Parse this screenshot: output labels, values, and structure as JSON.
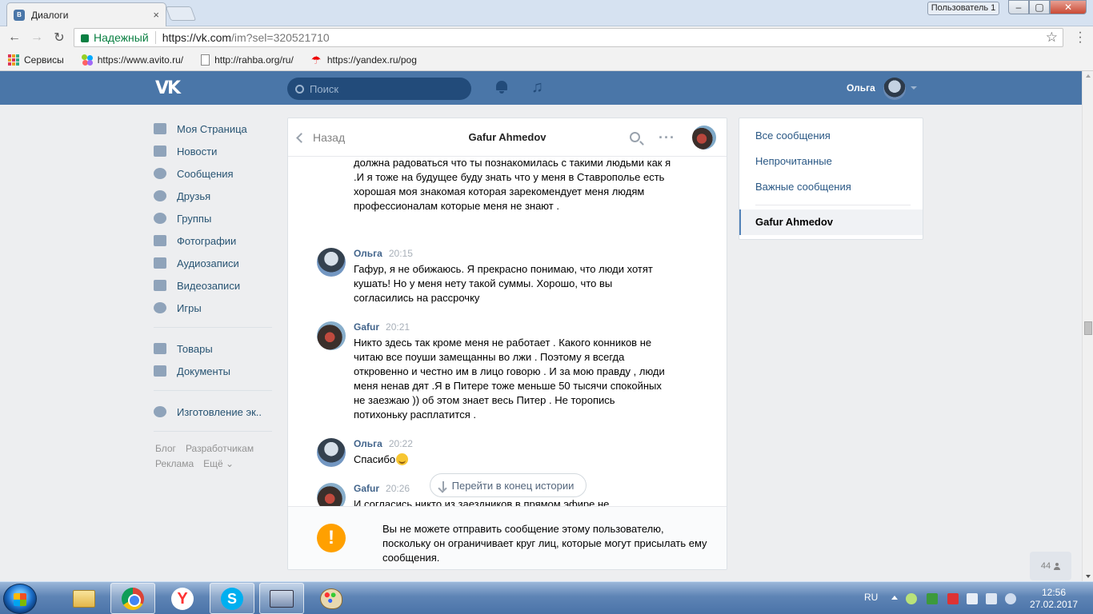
{
  "browser": {
    "tab_title": "Диалоги",
    "tab_close": "×",
    "profile_label": "Пользователь 1",
    "window_buttons": {
      "minimize": "‒",
      "maximize": "▢",
      "close": "✕"
    },
    "secure_label": "Надежный",
    "url_host": "https://vk.com",
    "url_path": "/im?sel=320521710",
    "bookmarks": [
      {
        "label": "Сервисы",
        "icon": "apps-icon"
      },
      {
        "label": "https://www.avito.ru/",
        "icon": "avito-icon"
      },
      {
        "label": "http://rahba.org/ru/",
        "icon": "page-icon"
      },
      {
        "label": "https://yandex.ru/pog",
        "icon": "umbrella-icon"
      }
    ]
  },
  "vk_header": {
    "logo": "VK",
    "search_placeholder": "Поиск",
    "user_name": "Ольга"
  },
  "left_menu": {
    "items": [
      {
        "label": "Моя Страница",
        "icon": "home-icon"
      },
      {
        "label": "Новости",
        "icon": "news-icon"
      },
      {
        "label": "Сообщения",
        "icon": "messages-icon"
      },
      {
        "label": "Друзья",
        "icon": "friends-icon"
      },
      {
        "label": "Группы",
        "icon": "groups-icon"
      },
      {
        "label": "Фотографии",
        "icon": "camera-icon"
      },
      {
        "label": "Аудиозаписи",
        "icon": "music-icon"
      },
      {
        "label": "Видеозаписи",
        "icon": "video-icon"
      },
      {
        "label": "Игры",
        "icon": "gamepad-icon"
      }
    ],
    "items2": [
      {
        "label": "Товары",
        "icon": "bag-icon"
      },
      {
        "label": "Документы",
        "icon": "document-icon"
      }
    ],
    "items3": [
      {
        "label": "Изготовление эк..",
        "icon": "group-icon"
      }
    ],
    "footer": {
      "blog": "Блог",
      "developers": "Разработчикам",
      "ads": "Реклама",
      "more": "Ещё ⌄"
    }
  },
  "dialog": {
    "back_label": "Назад",
    "title": "Gafur Ahmedov",
    "continued_text": "должна радоваться что ты познакомилась с такими людьми как я .И я тоже на будущее буду знать что у меня в Ставрополье есть хорошая моя знакомая которая зарекомендует меня людям профессионалам которые меня не знают .",
    "messages": [
      {
        "author": "Ольга",
        "time": "20:15",
        "text": "Гафур, я не обижаюсь. Я прекрасно понимаю, что люди хотят кушать! Но у меня нету такой суммы. Хорошо, что вы согласились на рассрочку"
      },
      {
        "author": "Gafur",
        "time": "20:21",
        "text": "Никто здесь так кроме меня не работает . Какого конников не читаю все поуши замещанны во лжи . Поэтому я всегда откровенно и честно им в лицо говорю . И за мою правду , люди меня ненав дят .Я в Питере тоже меньше 50 тысячи спокойных не заезжаю )) об этом знает весь Питер . Не торопись потихоньку расплатится ."
      },
      {
        "author": "Ольга",
        "time": "20:22",
        "text": "Спасибо"
      },
      {
        "author": "Gafur",
        "time": "20:26",
        "text": "И согласись никто из заездников в прямом эфире не"
      }
    ],
    "goto_end_label": "Перейти в конец истории",
    "warning_icon": "!",
    "warning_text": "Вы не можете отправить сообщение этому пользователю, поскольку он ограничивает круг лиц, которые могут присылать ему сообщения."
  },
  "right_menu": {
    "all": "Все сообщения",
    "unread": "Непрочитанные",
    "important": "Важные сообщения",
    "active": "Gafur Ahmedov"
  },
  "online_count": "44",
  "taskbar": {
    "lang": "RU",
    "time": "12:56",
    "date": "27.02.2017"
  }
}
